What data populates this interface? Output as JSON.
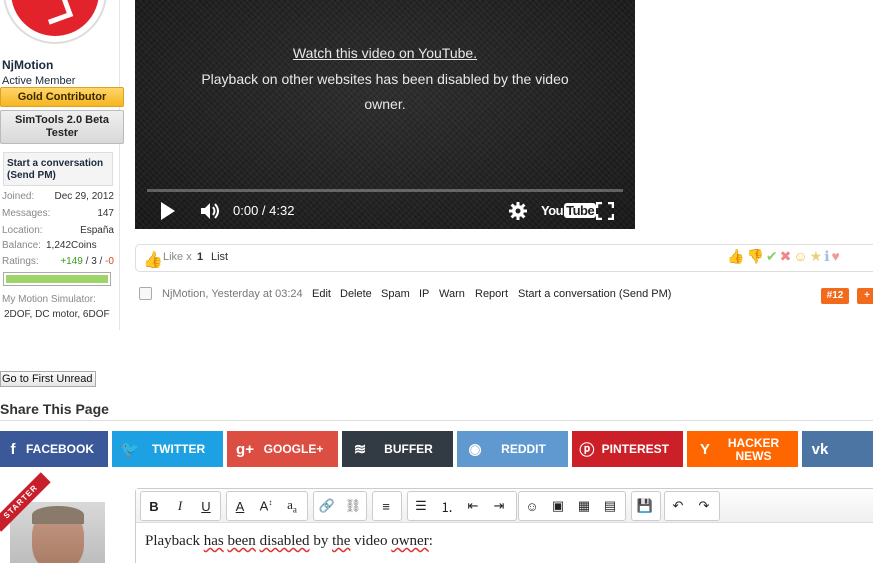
{
  "user": {
    "name": "NjMotion",
    "title": "Active Member",
    "banners": [
      "Gold Contributor",
      "SimTools 2.0 Beta Tester"
    ],
    "start_conversation": "Start a conversation (Send PM)",
    "info": [
      {
        "label": "Joined:",
        "value": "Dec 29, 2012"
      },
      {
        "label": "Messages:",
        "value": "147"
      },
      {
        "label": "Location:",
        "value": "España"
      },
      {
        "label": "Balance:",
        "value": "1,242Coins"
      }
    ],
    "ratings_label": "Ratings:",
    "ratings_pos": "+149",
    "ratings_sep": " / 3 / ",
    "ratings_neg": "-0",
    "rating_fraction": 1.0,
    "motion_label": "My Motion Simulator:",
    "motion_value": "2DOF, DC motor, 6DOF"
  },
  "video": {
    "link_text": "Watch this video on YouTube.",
    "message": "Playback on other websites has been disabled by the video owner.",
    "timecode": "0:00 / 4:32",
    "youtube_you": "You",
    "youtube_tube": "Tube"
  },
  "likes": {
    "text": "Like x",
    "count": "1",
    "list": "List"
  },
  "post": {
    "author_line": "NjMotion, Yesterday at 03:24",
    "links": [
      "Edit",
      "Delete",
      "Spam",
      "IP",
      "Warn",
      "Report",
      "Start a conversation (Send PM)"
    ],
    "number": "#12",
    "plus": "+"
  },
  "first_unread": "Go to First Unread",
  "share": {
    "title": "Share This Page",
    "buttons": [
      {
        "label": "FACEBOOK",
        "icon": "facebook-icon",
        "color": "#3b5998"
      },
      {
        "label": "TWITTER",
        "icon": "twitter-icon",
        "color": "#1da1e2"
      },
      {
        "label": "GOOGLE+",
        "icon": "google-plus-icon",
        "color": "#dc4e41"
      },
      {
        "label": "BUFFER",
        "icon": "buffer-icon",
        "color": "#323b43"
      },
      {
        "label": "REDDIT",
        "icon": "reddit-icon",
        "color": "#5f99cf"
      },
      {
        "label": "PINTEREST",
        "icon": "pinterest-icon",
        "color": "#cb2027"
      },
      {
        "label": "HACKER NEWS",
        "icon": "hacker-news-icon",
        "color": "#ff6600"
      },
      {
        "label": "VK",
        "icon": "vk-icon",
        "color": "#4c75a3"
      }
    ]
  },
  "editor": {
    "starter_ribbon": "STARTER",
    "text_parts": [
      "Playback ",
      "has",
      " ",
      "been",
      " ",
      "disabled",
      " by ",
      "the",
      " video ",
      "owner",
      ":"
    ]
  }
}
